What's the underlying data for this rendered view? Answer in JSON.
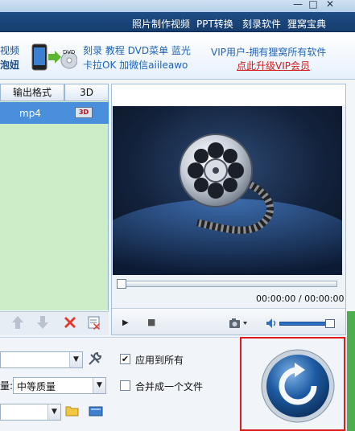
{
  "window": {
    "minimize_glyph": "—",
    "maximize_glyph": "□",
    "close_glyph": "✕"
  },
  "top_menu": {
    "items": [
      "照片制作视频",
      "PPT转换",
      "刻录软件",
      "狸窝宝典"
    ]
  },
  "banner": {
    "left_line1": "视频",
    "left_line2": "泡妞",
    "promo_line1": "刻录 教程 DVD菜单 蓝光",
    "promo_line2": "卡拉OK 加微信aiileawo",
    "vip_title": "VIP用户-拥有狸窝所有软件",
    "vip_link": "点此升级VIP会员"
  },
  "file_list": {
    "col_output_format": "输出格式",
    "col_3d": "3D",
    "rows": [
      {
        "format": "mp4",
        "badge": "3D"
      }
    ]
  },
  "player": {
    "time_display": "00:00:00 / 00:00:00",
    "seek_fraction": 0.0,
    "volume_fraction": 0.92
  },
  "settings": {
    "apply_all_label": "应用到所有",
    "apply_all_checked": true,
    "merge_label": "合并成一个文件",
    "merge_checked": false,
    "quality_prefix": "量:",
    "quality_value": "中等质量",
    "dropdown_arrow": "▼"
  },
  "colors": {
    "menu_bg": "#1a4578",
    "list_bg": "#cdecc8",
    "selected_row": "#4a8fdb",
    "convert_button": "#1d5aa0",
    "highlight_border": "#e01b1b"
  }
}
